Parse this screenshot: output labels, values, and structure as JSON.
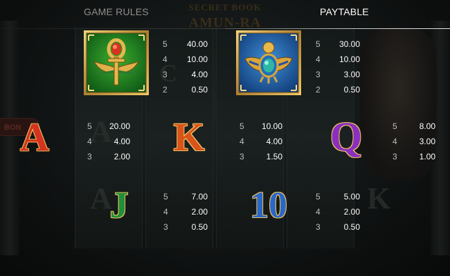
{
  "header": {
    "tabs": [
      {
        "label": "GAME RULES",
        "active": false
      },
      {
        "label": "PAYTABLE",
        "active": true
      }
    ]
  },
  "background": {
    "title_top": "SECRET BOOK",
    "title_main": "AMUN-RA",
    "bonus_label": "BON"
  },
  "symbols": [
    {
      "name": "ankh",
      "icon": "winged-ankh-icon",
      "tile_color": "#1f7a22",
      "pays": [
        {
          "count": "5",
          "value": "40.00"
        },
        {
          "count": "4",
          "value": "10.00"
        },
        {
          "count": "3",
          "value": "4.00"
        },
        {
          "count": "2",
          "value": "0.50"
        }
      ]
    },
    {
      "name": "scarab",
      "icon": "scarab-icon",
      "tile_color": "#1f5fa8",
      "pays": [
        {
          "count": "5",
          "value": "30.00"
        },
        {
          "count": "4",
          "value": "10.00"
        },
        {
          "count": "3",
          "value": "3.00"
        },
        {
          "count": "2",
          "value": "0.50"
        }
      ]
    },
    {
      "name": "A",
      "glyph": "A",
      "color": "#d7321f",
      "pays": [
        {
          "count": "5",
          "value": "20.00"
        },
        {
          "count": "4",
          "value": "4.00"
        },
        {
          "count": "3",
          "value": "2.00"
        }
      ]
    },
    {
      "name": "K",
      "glyph": "K",
      "color": "#d9531a",
      "pays": [
        {
          "count": "5",
          "value": "10.00"
        },
        {
          "count": "4",
          "value": "4.00"
        },
        {
          "count": "3",
          "value": "1.50"
        }
      ]
    },
    {
      "name": "Q",
      "glyph": "Q",
      "color": "#8a2fc0",
      "pays": [
        {
          "count": "5",
          "value": "8.00"
        },
        {
          "count": "4",
          "value": "3.00"
        },
        {
          "count": "3",
          "value": "1.00"
        }
      ]
    },
    {
      "name": "J",
      "glyph": "J",
      "color": "#1e8f3a",
      "pays": [
        {
          "count": "5",
          "value": "7.00"
        },
        {
          "count": "4",
          "value": "2.00"
        },
        {
          "count": "3",
          "value": "0.50"
        }
      ]
    },
    {
      "name": "10",
      "glyph": "10",
      "color": "#2868c8",
      "pays": [
        {
          "count": "5",
          "value": "5.00"
        },
        {
          "count": "4",
          "value": "2.00"
        },
        {
          "count": "3",
          "value": "0.50"
        }
      ]
    }
  ]
}
